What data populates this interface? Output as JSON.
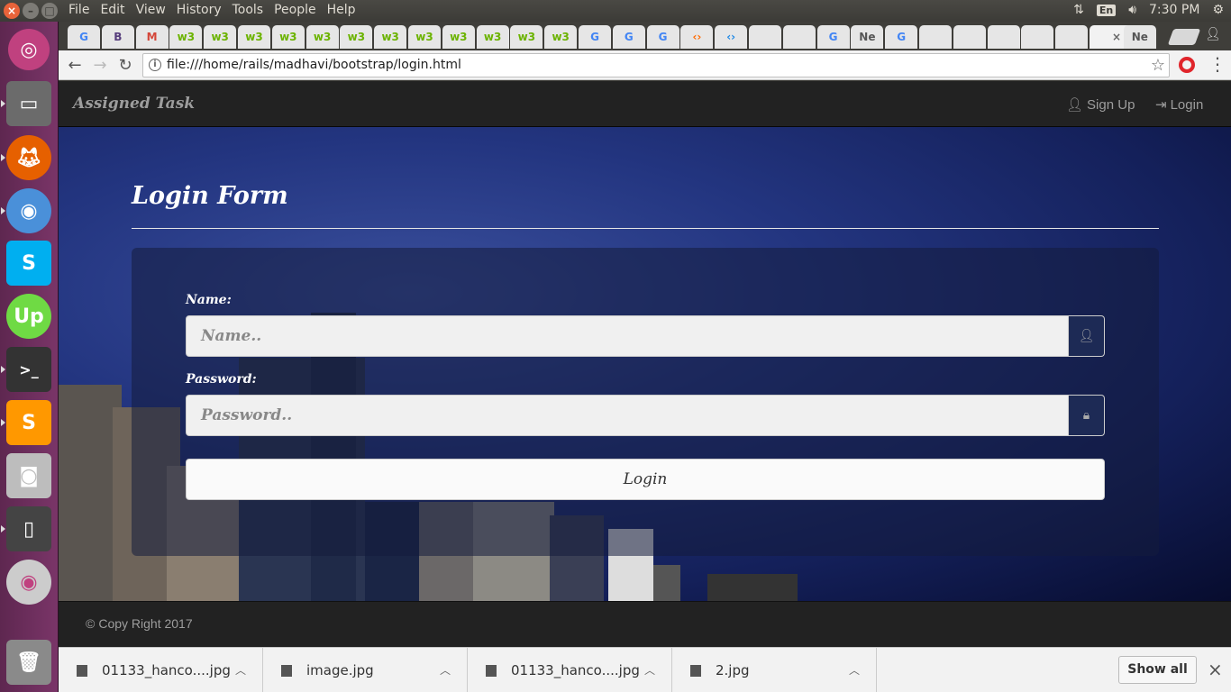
{
  "system": {
    "menus": [
      "File",
      "Edit",
      "View",
      "History",
      "Tools",
      "People",
      "Help"
    ],
    "keyboard_layout": "En",
    "clock": "7:30 PM"
  },
  "browser": {
    "tabs": [
      "G",
      "B",
      "M",
      "w3",
      "w3",
      "w3",
      "w3",
      "w3",
      "w3",
      "w3",
      "w3",
      "w3",
      "w3",
      "w3",
      "w3",
      "G",
      "G",
      "G",
      "‹›",
      "‹›",
      "",
      "",
      "G",
      "Ne",
      "G",
      "",
      "",
      "",
      "",
      "",
      "",
      "Ne"
    ],
    "active_tab_close": "×",
    "url": "file:///home/rails/madhavi/bootstrap/login.html"
  },
  "navbar": {
    "brand": "Assigned Task",
    "signup_label": "Sign Up",
    "login_label": "Login"
  },
  "form": {
    "title": "Login Form",
    "name_label": "Name:",
    "name_placeholder": "Name..",
    "password_label": "Password:",
    "password_placeholder": "Password..",
    "submit_label": "Login"
  },
  "footer": {
    "copyright": "Copy Right 2017"
  },
  "downloads": {
    "items": [
      {
        "filename": "01133_hanco....jpg"
      },
      {
        "filename": "image.jpg"
      },
      {
        "filename": "01133_hanco....jpg"
      },
      {
        "filename": "2.jpg"
      }
    ],
    "show_all_label": "Show all"
  },
  "colors": {
    "navbar_bg": "#222222",
    "navbar_text": "#9d9d9d",
    "launcher_bg": "#7a3568",
    "hero_blue": "#233580"
  }
}
